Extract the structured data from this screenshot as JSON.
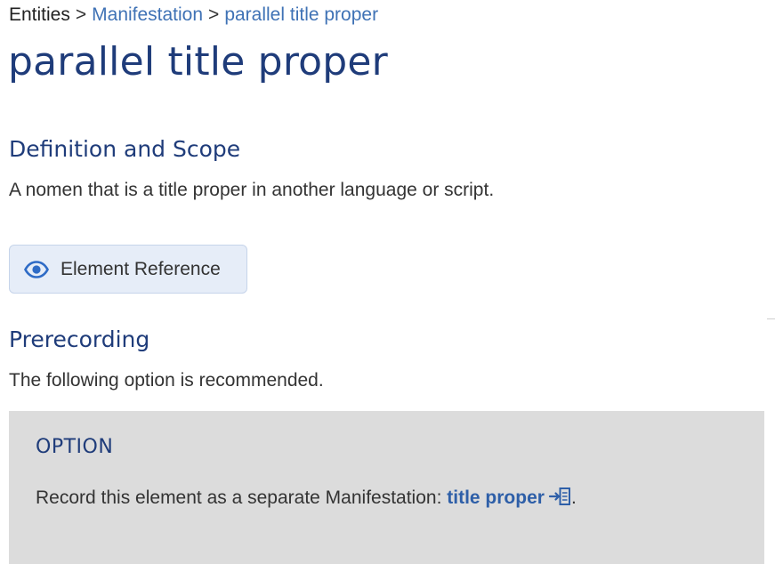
{
  "breadcrumb": {
    "items": [
      "Entities",
      "Manifestation",
      "parallel title proper"
    ],
    "separator": ">"
  },
  "page_title": "parallel title proper",
  "definition": {
    "heading": "Definition and Scope",
    "text": "A nomen that is a title proper in another language or script."
  },
  "element_reference": {
    "label": "Element Reference",
    "icon": "eye-icon"
  },
  "prerecording": {
    "heading": "Prerecording",
    "text": "The following option is recommended."
  },
  "option": {
    "title": "OPTION",
    "text_before": "Record this element as a separate Manifestation: ",
    "link_text": "title proper",
    "link_icon": "jump-to-element-icon",
    "text_after": "."
  },
  "colors": {
    "heading": "#1f3c7a",
    "link": "#3f72b5",
    "option_bg": "#dcdcdc",
    "button_bg": "#e6edf8"
  }
}
